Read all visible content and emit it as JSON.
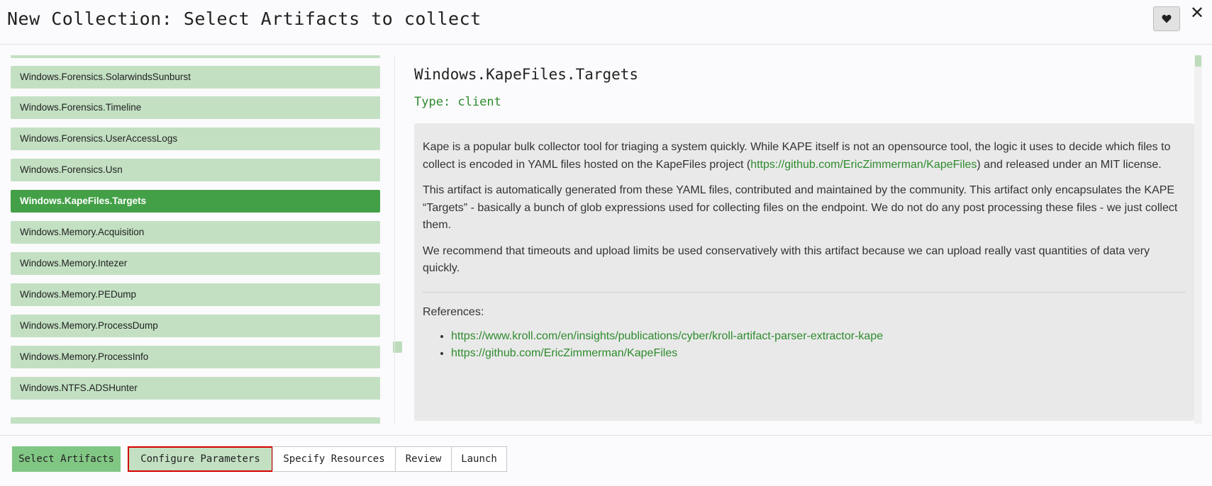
{
  "dialog": {
    "title": "New Collection: Select Artifacts to collect",
    "favorite_icon": "heart-icon",
    "close_label": "✕"
  },
  "artifact_list": {
    "items": [
      {
        "label": "Windows.Forensics.SolarwindsSunburst",
        "selected": false
      },
      {
        "label": "Windows.Forensics.Timeline",
        "selected": false
      },
      {
        "label": "Windows.Forensics.UserAccessLogs",
        "selected": false
      },
      {
        "label": "Windows.Forensics.Usn",
        "selected": false
      },
      {
        "label": "Windows.KapeFiles.Targets",
        "selected": true
      },
      {
        "label": "Windows.Memory.Acquisition",
        "selected": false
      },
      {
        "label": "Windows.Memory.Intezer",
        "selected": false
      },
      {
        "label": "Windows.Memory.PEDump",
        "selected": false
      },
      {
        "label": "Windows.Memory.ProcessDump",
        "selected": false
      },
      {
        "label": "Windows.Memory.ProcessInfo",
        "selected": false
      },
      {
        "label": "Windows.NTFS.ADSHunter",
        "selected": false
      }
    ]
  },
  "detail": {
    "title": "Windows.KapeFiles.Targets",
    "type": "Type: client",
    "description": {
      "p1_before": "Kape is a popular bulk collector tool for triaging a system quickly. While KAPE itself is not an opensource tool, the logic it uses to decide which files to collect is encoded in YAML files hosted on the KapeFiles project (",
      "p1_link": "https://github.com/EricZimmerman/KapeFiles",
      "p1_after": ") and released under an MIT license.",
      "p2": "This artifact is automatically generated from these YAML files, contributed and maintained by the community. This artifact only encapsulates the KAPE “Targets” - basically a bunch of glob expressions used for collecting files on the endpoint. We do not do any post processing these files - we just collect them.",
      "p3": "We recommend that timeouts and upload limits be used conservatively with this artifact because we can upload really vast quantities of data very quickly.",
      "references_label": "References:",
      "references": [
        "https://www.kroll.com/en/insights/publications/cyber/kroll-artifact-parser-extractor-kape",
        "https://github.com/EricZimmerman/KapeFiles"
      ]
    }
  },
  "wizard_steps": [
    {
      "label": "Select Artifacts",
      "active": true
    },
    {
      "label": "Configure Parameters",
      "highlighted": true
    },
    {
      "label": "Specify Resources"
    },
    {
      "label": "Review"
    },
    {
      "label": "Launch"
    }
  ],
  "colors": {
    "item_bg": "#c3e0c3",
    "selected_bg": "#43a047",
    "link": "#2e8b2e",
    "highlight_border": "#d50000"
  }
}
